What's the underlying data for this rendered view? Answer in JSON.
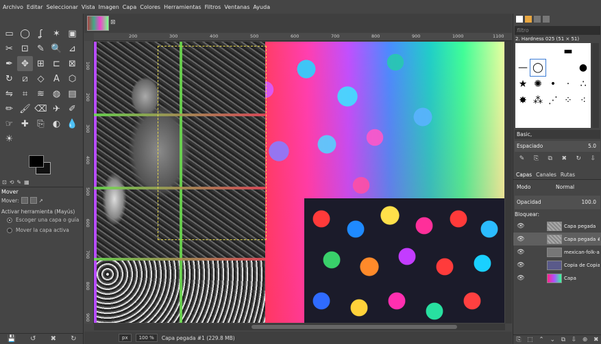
{
  "menu": [
    "Archivo",
    "Editar",
    "Seleccionar",
    "Vista",
    "Imagen",
    "Capa",
    "Colores",
    "Herramientas",
    "Filtros",
    "Ventanas",
    "Ayuda"
  ],
  "toolbox": {
    "tools": [
      "rect-select-icon",
      "ellipse-select-icon",
      "lasso-icon",
      "magic-wand-icon",
      "color-select-icon",
      "scissors-icon",
      "foreground-select-icon",
      "color-picker-icon",
      "zoom-icon",
      "measure-icon",
      "paths-icon",
      "move-icon",
      "align-icon",
      "crop-icon",
      "unified-transform-icon",
      "rotate-icon",
      "shear-icon",
      "perspective-icon",
      "text-icon",
      "3d-transform-icon",
      "flip-icon",
      "cage-icon",
      "warp-icon",
      "bucket-fill-icon",
      "gradient-icon",
      "pencil-icon",
      "paintbrush-icon",
      "eraser-icon",
      "airbrush-icon",
      "ink-icon",
      "smudge-icon",
      "heal-icon",
      "clone-icon",
      "dodge-icon",
      "blur-icon",
      "dodge-burn-icon"
    ],
    "tool_glyphs": [
      "▭",
      "◯",
      "ʆ",
      "✶",
      "▣",
      "✂",
      "⊡",
      "✎",
      "🔍",
      "⊿",
      "✒",
      "✥",
      "⊞",
      "⊏",
      "⊠",
      "↻",
      "⧄",
      "◇",
      "A",
      "⬡",
      "⇋",
      "⌗",
      "≋",
      "◍",
      "▤",
      "✏",
      "🖌",
      "⌫",
      "✈",
      "✐",
      "☞",
      "✚",
      "⎘",
      "◐",
      "💧",
      "☀"
    ],
    "tabs": [
      "⊡",
      "⟲",
      "✎",
      "▦"
    ],
    "options_title": "Mover",
    "move_label": "Mover:",
    "activate_label": "Activar herramienta  (Mayús)",
    "radio1": "Escoger una capa o guía",
    "radio2": "Mover la capa activa",
    "bottom": [
      "💾",
      "↺",
      "✖",
      "↻"
    ]
  },
  "image_tab_close": "⊠",
  "ruler": {
    "h": [
      "200",
      "300",
      "400",
      "500",
      "600",
      "700",
      "800",
      "900",
      "1000",
      "1100",
      "1200"
    ],
    "v": [
      "100",
      "200",
      "300",
      "400",
      "500",
      "600",
      "700",
      "800",
      "900"
    ]
  },
  "status": {
    "unit": "px",
    "zoom": "100 %",
    "info": "Capa pegada #1 (229.8 MB)"
  },
  "dock": {
    "filter_placeholder": "filtro",
    "brush_name": "2. Hardness 025 (51 × 51)",
    "brush_preset": "Basic,",
    "spacing_label": "Espaciado",
    "spacing_value": "5.0",
    "layer_tabs": [
      "Capas",
      "Canales",
      "Rutas"
    ],
    "mode_label": "Modo",
    "mode_value": "Normal",
    "opacity_label": "Opacidad",
    "opacity_value": "100.0",
    "lock_label": "Bloquear:",
    "layers": [
      {
        "name": "Capa pegada"
      },
      {
        "name": "Capa pegada #1"
      },
      {
        "name": "mexican-folk-arts"
      },
      {
        "name": "Copia de Copia de"
      },
      {
        "name": "Capa"
      }
    ],
    "brush_actions": [
      "✎",
      "⎘",
      "⧉",
      "✖",
      "↻",
      "⇩"
    ],
    "bottom": [
      "⎘",
      "⬚",
      "⌃",
      "⌄",
      "⧉",
      "⇩",
      "⊕",
      "✖"
    ]
  }
}
